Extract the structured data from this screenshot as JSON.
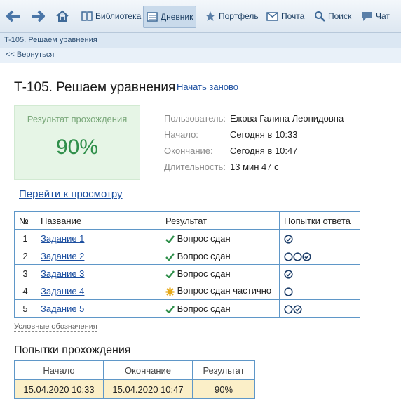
{
  "toolbar": {
    "back_icon": "arrow-left-icon",
    "forward_icon": "arrow-right-icon",
    "home_icon": "home-icon",
    "library": "Библиотека",
    "diary": "Дневник",
    "portfolio": "Портфель",
    "mail": "Почта",
    "search": "Поиск",
    "chat": "Чат"
  },
  "breadcrumb": "T-105. Решаем уравнения",
  "back_link": "<< Вернуться",
  "page_title": "Т-105. Решаем уравнения",
  "restart_link": "Начать заново",
  "result": {
    "label": "Результат прохождения",
    "percent": "90%",
    "box_color": "#e6f5e6"
  },
  "info": {
    "user_key": "Пользователь:",
    "user_val": "Ежова Галина Леонидовна",
    "start_key": "Начало:",
    "start_val": "Сегодня в 10:33",
    "end_key": "Окончание:",
    "end_val": "Сегодня в 10:47",
    "dur_key": "Длительность:",
    "dur_val": "13 мин 47 с"
  },
  "review_link": "Перейти к просмотру",
  "tasks_table": {
    "headers": [
      "№",
      "Название",
      "Результат",
      "Попытки ответа"
    ],
    "rows": [
      {
        "num": "1",
        "name": "Задание 1",
        "result": "Вопрос сдан",
        "status": "passed",
        "attempts": [
          "correct"
        ]
      },
      {
        "num": "2",
        "name": "Задание 2",
        "result": "Вопрос сдан",
        "status": "passed",
        "attempts": [
          "wrong",
          "wrong",
          "correct"
        ]
      },
      {
        "num": "3",
        "name": "Задание 3",
        "result": "Вопрос сдан",
        "status": "passed",
        "attempts": [
          "correct"
        ]
      },
      {
        "num": "4",
        "name": "Задание 4",
        "result": "Вопрос сдан частично",
        "status": "partial",
        "attempts": [
          "wrong"
        ]
      },
      {
        "num": "5",
        "name": "Задание 5",
        "result": "Вопрос сдан",
        "status": "passed",
        "attempts": [
          "wrong",
          "correct"
        ]
      }
    ]
  },
  "legend_link": "Условные обозначения",
  "attempts_title": "Попытки прохождения",
  "attempts_table": {
    "headers": [
      "Начало",
      "Окончание",
      "Результат"
    ],
    "rows": [
      {
        "start": "15.04.2020 10:33",
        "end": "15.04.2020 10:47",
        "result": "90%"
      }
    ]
  },
  "colors": {
    "accent": "#1c4fa0",
    "success": "#2f8f4a",
    "partial": "#e6a817",
    "table_border": "#5f97c8",
    "attempt_row": "#fbefc8"
  }
}
